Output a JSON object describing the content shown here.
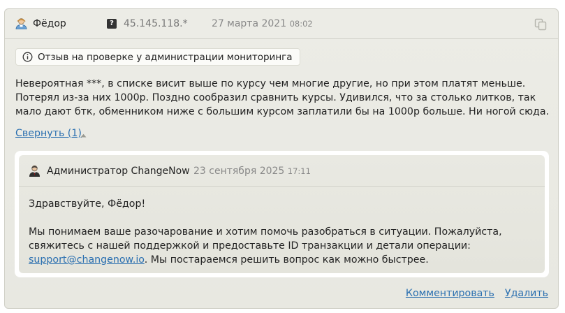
{
  "review": {
    "author": "Фёдор",
    "ip_badge": "?",
    "ip": "45.145.118.*",
    "date": "27 марта 2021",
    "time": "08:02",
    "status": "Отзыв на проверке у администрации мониторинга",
    "text": "Невероятная ***, в списке висит выше по курсу чем многие другие, но при этом платят меньше. Потерял из-за них 1000р. Поздно сообразил сравнить курсы. Удивился, что за столько литков, так мало дают бтк, обменником ниже с большим курсом заплатили бы на 1000р больше. Ни ногой сюда.",
    "collapse_label": "Свернуть (1)"
  },
  "reply": {
    "author": "Администратор ChangeNow",
    "date": "23 сентября 2025",
    "time": "17:11",
    "greeting": "Здравствуйте, Фёдор!",
    "body_before_link": "Мы понимаем ваше разочарование и хотим помочь разобраться в ситуации. Пожалуйста, свяжитесь с нашей поддержкой и предоставьте ID транзакции и детали операции: ",
    "link": "support@changenow.io",
    "body_after_link": ". Мы постараемся решить вопрос как можно быстрее."
  },
  "actions": {
    "comment": "Комментировать",
    "delete": "Удалить"
  },
  "icons": {
    "user": "user-icon",
    "admin": "admin-icon",
    "info": "info-icon",
    "copy": "copy-icon",
    "caret": "caret-up-icon"
  },
  "colors": {
    "link": "#2a6fb0",
    "card_bg": "#ebebe4"
  }
}
